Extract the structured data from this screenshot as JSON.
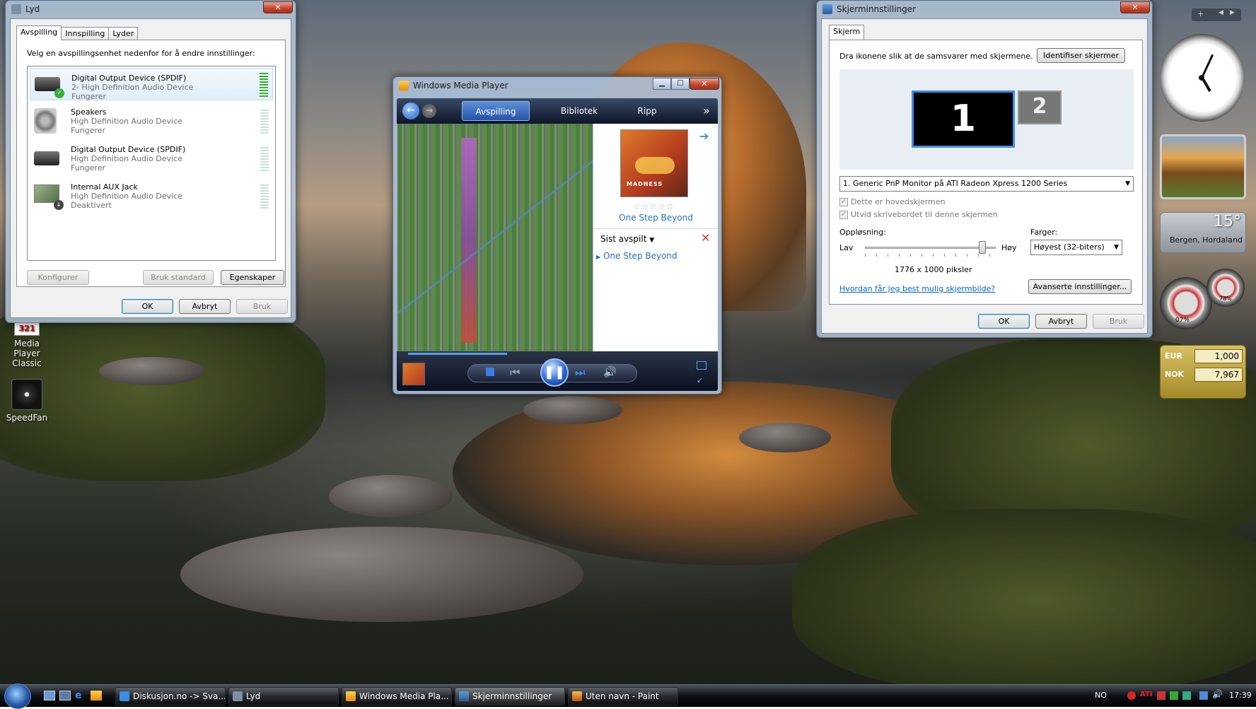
{
  "sound_dialog": {
    "title": "Lyd",
    "tabs": [
      "Avspilling",
      "Innspilling",
      "Lyder"
    ],
    "instruction": "Velg en avspillingsenhet nedenfor for å endre innstillinger:",
    "devices": [
      {
        "name": "Digital Output Device (SPDIF)",
        "sub": "2- High Definition Audio Device",
        "status": "Fungerer"
      },
      {
        "name": "Speakers",
        "sub": "High Definition Audio Device",
        "status": "Fungerer"
      },
      {
        "name": "Digital Output Device (SPDIF)",
        "sub": "High Definition Audio Device",
        "status": "Fungerer"
      },
      {
        "name": "Internal AUX Jack",
        "sub": "High Definition Audio Device",
        "status": "Deaktivert"
      }
    ],
    "configure": "Konfigurer",
    "set_default": "Bruk standard",
    "properties": "Egenskaper",
    "ok": "OK",
    "cancel": "Avbryt",
    "apply": "Bruk"
  },
  "wmp": {
    "title": "Windows Media Player",
    "tabs": [
      "Avspilling",
      "Bibliotek",
      "Ripp"
    ],
    "more": "»",
    "album_title": "One Step Beyond",
    "album_art_text": "MADNESS",
    "list_title": "Sist avspilt",
    "list_item": "One Step Beyond"
  },
  "display": {
    "title": "Skjerminnstillinger",
    "tab": "Skjerm",
    "instruction": "Dra ikonene slik at de samsvarer med skjermene.",
    "identify": "Identifiser skjermer",
    "monitor1": "1",
    "monitor2": "2",
    "monitor_select": "1. Generic PnP Monitor på ATI Radeon Xpress 1200 Series",
    "primary_check": "Dette er hovedskjermen",
    "extend_check": "Utvid skrivebordet til denne skjermen",
    "resolution_label": "Oppløsning:",
    "low": "Lav",
    "high": "Høy",
    "resolution_value": "1776 x 1000 piksler",
    "colors_label": "Farger:",
    "colors_value": "Høyest (32-biters)",
    "help_link": "Hvordan får jeg best mulig skjermbilde?",
    "advanced": "Avanserte innstillinger...",
    "ok": "OK",
    "cancel": "Avbryt",
    "apply": "Bruk"
  },
  "desktop_icons": [
    {
      "label": "Media Player Classic",
      "badge": "321"
    },
    {
      "label": "SpeedFan"
    }
  ],
  "gadgets": {
    "weather_temp": "15°",
    "weather_place": "Bergen, Hordaland",
    "cpu_pct": "07%",
    "mem_pct": "78%",
    "currency": [
      {
        "code": "EUR",
        "value": "1,000"
      },
      {
        "code": "NOK",
        "value": "7,967"
      }
    ]
  },
  "taskbar": {
    "items": [
      "Diskusjon.no -> Sva...",
      "Lyd",
      "Windows Media Pla...",
      "Skjerminnstillinger",
      "Uten navn - Paint"
    ],
    "lang": "NO",
    "clock": "17:39"
  },
  "colors": {
    "accent_blue": "#3c7fb1",
    "link": "#0066cc",
    "wmp_link": "#1f6fc2"
  }
}
